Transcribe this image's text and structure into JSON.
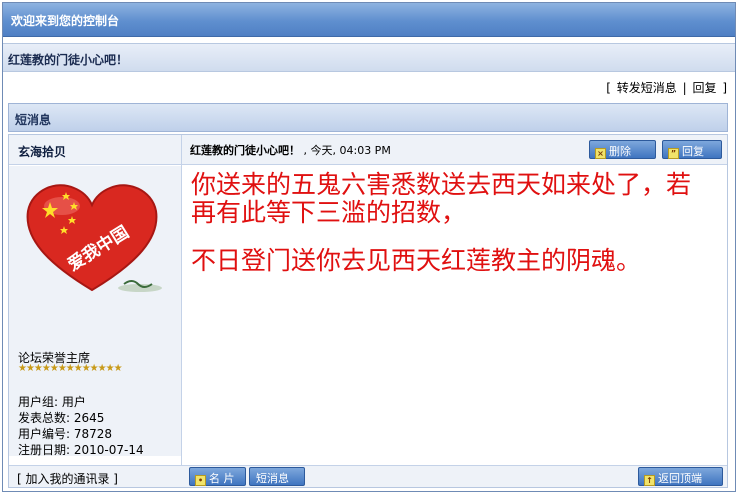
{
  "header": {
    "title": "欢迎来到您的控制台"
  },
  "breadcrumb": {
    "current": "红莲教的门徒小心吧！"
  },
  "actions": {
    "forward": "转发短消息",
    "separator": "|",
    "reply": "回复",
    "bracket_open": "[",
    "bracket_close": "]"
  },
  "section": {
    "title": "短消息"
  },
  "post": {
    "author": "玄海拾贝",
    "title": "红莲教的门徒小心吧！",
    "date": ", 今天, 04:03 PM",
    "delete_label": "删除",
    "reply_label": "回复",
    "content_line1": "你送来的五鬼六害悉数送去西天如来处了，若再有此等下三滥的招数，",
    "content_line2": "不日登门送你去见西天红莲教主的阴魂。",
    "avatar_text": "爱我中国"
  },
  "profile": {
    "rank": "论坛荣誉主席",
    "stars": "★★★★★★★★★★★★★",
    "group_label": "用户组: 用户",
    "posts_label": "发表总数: 2645",
    "id_label": "用户编号: 78728",
    "reg_label": "注册日期: 2010-07-14"
  },
  "footer": {
    "add_contact": "[ 加入我的通讯录 ]",
    "card_label": "名 片",
    "pm_label": "短消息",
    "top_label": "返回顶端"
  },
  "colors": {
    "accent": "#5f8fcf",
    "content_red": "#e01010"
  }
}
